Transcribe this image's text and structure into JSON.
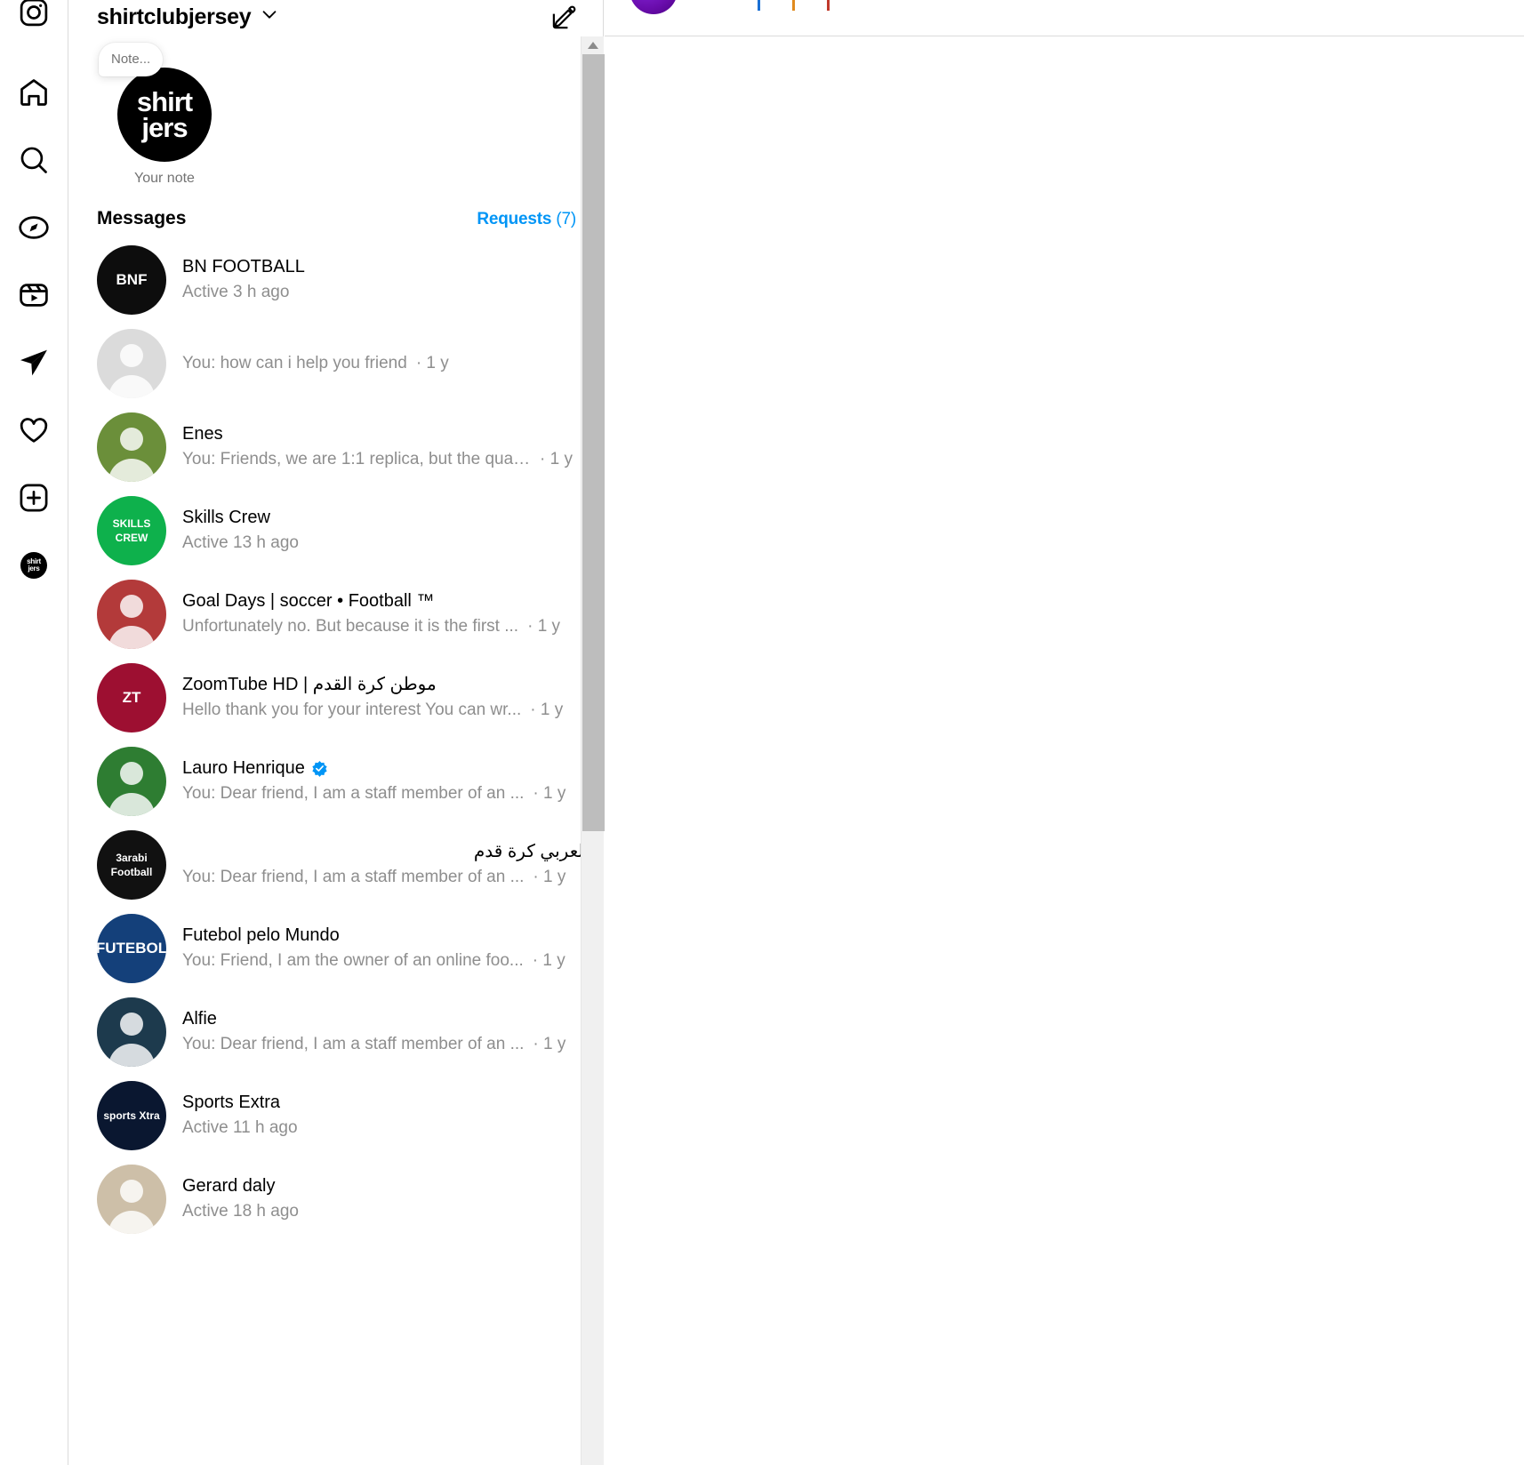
{
  "app": {
    "name": "Instagram Direct"
  },
  "nav": {
    "items": [
      {
        "name": "instagram-logo",
        "label": "Instagram"
      },
      {
        "name": "home-icon",
        "label": "Home"
      },
      {
        "name": "search-icon",
        "label": "Search"
      },
      {
        "name": "explore-icon",
        "label": "Explore"
      },
      {
        "name": "reels-icon",
        "label": "Reels"
      },
      {
        "name": "messages-icon",
        "label": "Messages"
      },
      {
        "name": "notifications-icon",
        "label": "Notifications"
      },
      {
        "name": "create-icon",
        "label": "Create"
      },
      {
        "name": "profile-avatar",
        "label": "Profile"
      }
    ],
    "avatar_line1": "shirt",
    "avatar_line2": "jers"
  },
  "inbox": {
    "username": "shirtclubjersey",
    "chevron_icon": "chevron-down-icon",
    "compose_icon": "new-message-icon",
    "note": {
      "bubble_text": "Note...",
      "label": "Your note",
      "avatar_line1": "shirt",
      "avatar_line2": "jers"
    },
    "messages_heading": "Messages",
    "requests_label": "Requests",
    "requests_count": "(7)",
    "threads": [
      {
        "name": "BN FOOTBALL",
        "preview": "Active 3 h ago",
        "time": "",
        "verified": false,
        "avatar_text": "BNF",
        "avatar_bg": "#0d0d0d",
        "avatar_fg": "#ffffff"
      },
      {
        "name": "",
        "preview": "You: how can i help you friend",
        "time": "· 1 y",
        "verified": false,
        "avatar_text": "",
        "avatar_bg": "#dbdbdb",
        "avatar_fg": "#ffffff"
      },
      {
        "name": "Enes",
        "preview": "You: Friends, we are 1:1 replica, but the quali...",
        "time": "· 1 y",
        "verified": false,
        "avatar_text": "",
        "avatar_bg": "#6b8f3a",
        "avatar_fg": "#ffffff"
      },
      {
        "name": "Skills Crew",
        "preview": "Active 13 h ago",
        "time": "",
        "verified": false,
        "avatar_text": "SKILLS CREW",
        "avatar_bg": "#0eb14c",
        "avatar_fg": "#ffffff"
      },
      {
        "name": "Goal Days | soccer • Football ™",
        "preview": "Unfortunately no. But because it is the first ...",
        "time": "· 1 y",
        "verified": false,
        "avatar_text": "",
        "avatar_bg": "#b33a3a",
        "avatar_fg": "#ffffff"
      },
      {
        "name": "ZoomTube HD | موطن كرة القدم",
        "preview": "Hello thank you for your interest You can wr...",
        "time": "· 1 y",
        "verified": false,
        "avatar_text": "ZT",
        "avatar_bg": "#9d0f31",
        "avatar_fg": "#ffffff"
      },
      {
        "name": "Lauro Henrique",
        "preview": "You: Dear friend, I am a staff member of an ...",
        "time": "· 1 y",
        "verified": true,
        "avatar_text": "",
        "avatar_bg": "#2e7d32",
        "avatar_fg": "#ffffff"
      },
      {
        "name": "العربي كرة قدم",
        "preview": "You: Dear friend, I am a staff member of an ...",
        "time": "· 1 y",
        "verified": false,
        "avatar_text": "3arabi Football",
        "avatar_bg": "#111111",
        "avatar_fg": "#ffffff",
        "rtl": true
      },
      {
        "name": "Futebol pelo Mundo",
        "preview": "You: Friend, I am the owner of an online foo...",
        "time": "· 1 y",
        "verified": false,
        "avatar_text": "FUTEBOL",
        "avatar_bg": "#14407a",
        "avatar_fg": "#ffffff"
      },
      {
        "name": "Alfie",
        "preview": "You: Dear friend, I am a staff member of an ...",
        "time": "· 1 y",
        "verified": false,
        "avatar_text": "",
        "avatar_bg": "#1d3a4d",
        "avatar_fg": "#ffffff"
      },
      {
        "name": "Sports Extra",
        "preview": "Active 11 h ago",
        "time": "",
        "verified": false,
        "avatar_text": "sports Xtra",
        "avatar_bg": "#0a1730",
        "avatar_fg": "#ffffff"
      },
      {
        "name": "Gerard daly",
        "preview": "Active 18 h ago",
        "time": "",
        "verified": false,
        "avatar_text": "",
        "avatar_bg": "#cdbfa8",
        "avatar_fg": "#ffffff"
      }
    ]
  },
  "scrollbar": {
    "up_arrow_icon": "scroll-up-arrow-icon"
  },
  "colors": {
    "link_blue": "#0095f6",
    "verified_blue": "#0095f6",
    "secondary_text": "#8e8e8e",
    "border": "#dbdbdb",
    "pane_avatar_purple": "#6a0dad"
  }
}
